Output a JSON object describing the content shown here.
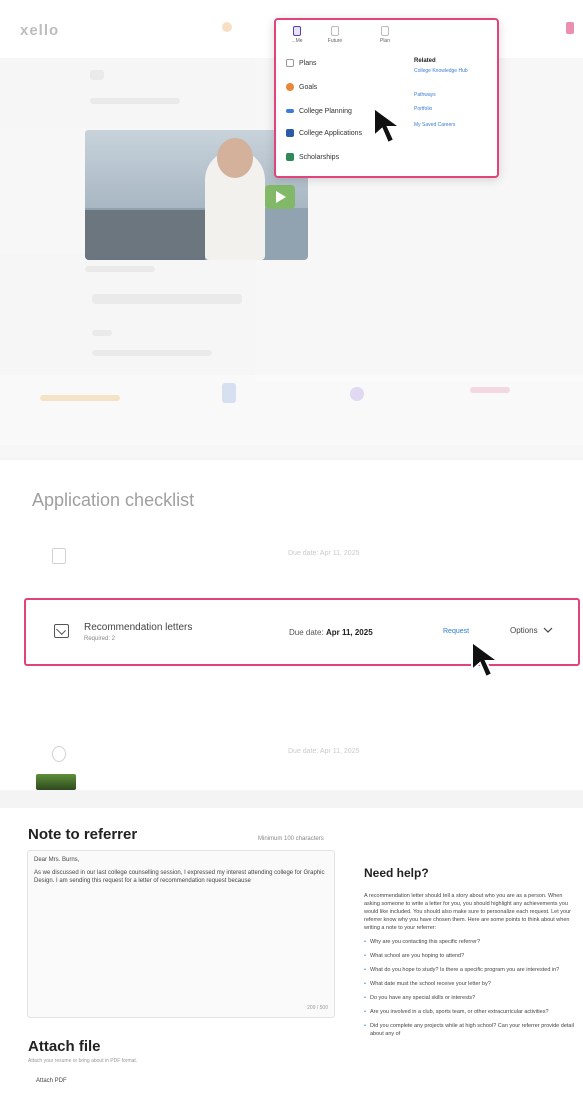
{
  "app": {
    "logo": "xello"
  },
  "dropdown": {
    "tabs": [
      {
        "label": "...Me"
      },
      {
        "label": "Future"
      },
      {
        "label": "Plan"
      }
    ],
    "items": [
      {
        "label": "Plans",
        "icon": "plans-icon",
        "color": "#999999"
      },
      {
        "label": "Goals",
        "icon": "goals-icon",
        "color": "#e8873a"
      },
      {
        "label": "College Planning",
        "icon": "college-planning-icon",
        "color": "#3b7dd8"
      },
      {
        "label": "College Applications",
        "icon": "college-applications-icon",
        "color": "#2b5aa8"
      },
      {
        "label": "Scholarships",
        "icon": "scholarships-icon",
        "color": "#2e8b57"
      }
    ],
    "related_title": "Related",
    "related_links": [
      "College Knowledge Hub",
      "Pathways",
      "Portfolio",
      "My Saved Careers"
    ]
  },
  "checklist": {
    "title": "Application checklist",
    "recommendation": {
      "title": "Recommendation letters",
      "sub": "Required: 2",
      "due_label": "Due date:",
      "due_value": "Apr 11, 2025",
      "request": "Request",
      "options": "Options"
    },
    "other_due": "Due date: Apr 11, 2025"
  },
  "note": {
    "title": "Note to referrer",
    "min_chars": "Minimum 100 characters",
    "greeting": "Dear Mrs. Burns,",
    "body": "As we discussed in our last college counselling session, I expressed my interest attending college for Graphic Design. I am sending this request for a letter of recommendation request because",
    "count": "209 / 500"
  },
  "attach": {
    "title": "Attach file",
    "sub": "Attach your resume or bring about in PDF format.",
    "link": "Attach PDF"
  },
  "help": {
    "title": "Need help?",
    "intro": "A recommendation letter should tell a story about who you are as a person. When asking someone to write a letter for you, you should highlight any achievements you would like included. You should also make sure to personalize each request. Let your referrer know why you have chosen them. Here are some points to think about when writing a note to your referrer:",
    "items": [
      "Why are you contacting this specific referrer?",
      "What school are you hoping to attend?",
      "What do you hope to study? Is there a specific program you are interested in?",
      "What date must the school receive your letter by?",
      "Do you have any special skills or interests?",
      "Are you involved in a club, sports team, or other extracurricular activities?",
      "Did you complete any projects while at high school? Can your referrer provide detail about any of"
    ]
  }
}
